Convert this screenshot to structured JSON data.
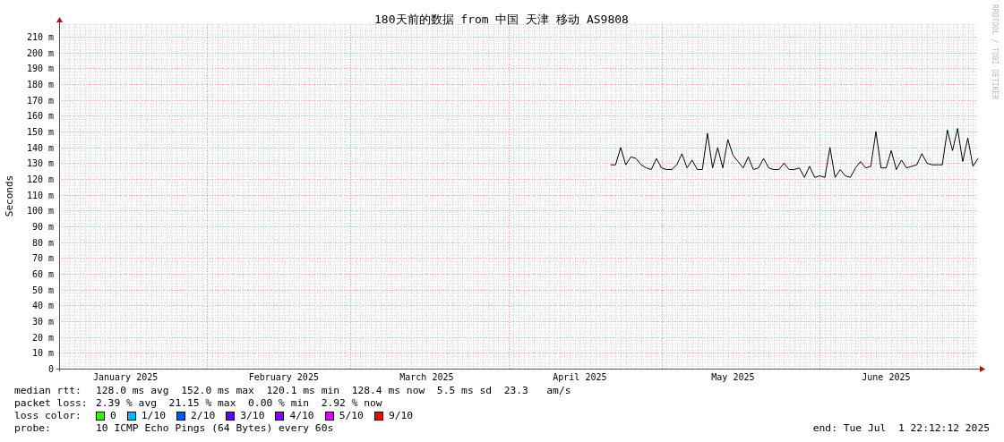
{
  "graph": {
    "credit": "RRDTOOL / TOBI OETIKER",
    "chart_data": {
      "type": "line",
      "title": "180天前的数据 from 中国 天津 移动 AS9808",
      "ylabel": "Seconds",
      "ylim": [
        0,
        218
      ],
      "grid": true,
      "categories": [
        null,
        null,
        null,
        null,
        null,
        null,
        null,
        null,
        null,
        null,
        null,
        null,
        null,
        "January 2025",
        null,
        null,
        null,
        null,
        null,
        null,
        null,
        null,
        null,
        null,
        null,
        null,
        null,
        null,
        null,
        null,
        null,
        null,
        null,
        null,
        null,
        null,
        null,
        null,
        null,
        null,
        null,
        null,
        null,
        null,
        "February 2025",
        null,
        null,
        null,
        null,
        null,
        null,
        null,
        null,
        null,
        null,
        null,
        null,
        null,
        null,
        null,
        null,
        null,
        null,
        null,
        null,
        null,
        null,
        null,
        null,
        null,
        null,
        null,
        "March 2025",
        null,
        null,
        null,
        null,
        null,
        null,
        null,
        null,
        null,
        null,
        null,
        null,
        null,
        null,
        null,
        null,
        null,
        null,
        null,
        null,
        null,
        null,
        null,
        null,
        null,
        null,
        null,
        null,
        null,
        "April 2025",
        null,
        null,
        null,
        null,
        null,
        null,
        null,
        null,
        null,
        null,
        null,
        null,
        null,
        null,
        null,
        null,
        null,
        null,
        null,
        null,
        null,
        null,
        null,
        null,
        null,
        null,
        null,
        null,
        null,
        "May 2025",
        null,
        null,
        null,
        null,
        null,
        null,
        null,
        null,
        null,
        null,
        null,
        null,
        null,
        null,
        null,
        null,
        null,
        null,
        null,
        null,
        null,
        null,
        null,
        null,
        null,
        null,
        null,
        null,
        null,
        "June 2025",
        null,
        null,
        null,
        null,
        null,
        null,
        null,
        null,
        null,
        null,
        null,
        null,
        null,
        null,
        null,
        null,
        null,
        null
      ],
      "yticks": [
        {
          "value": 0,
          "label": "0"
        },
        {
          "value": 10,
          "label": "10 m"
        },
        {
          "value": 20,
          "label": "20 m"
        },
        {
          "value": 30,
          "label": "30 m"
        },
        {
          "value": 40,
          "label": "40 m"
        },
        {
          "value": 50,
          "label": "50 m"
        },
        {
          "value": 60,
          "label": "60 m"
        },
        {
          "value": 70,
          "label": "70 m"
        },
        {
          "value": 80,
          "label": "80 m"
        },
        {
          "value": 90,
          "label": "90 m"
        },
        {
          "value": 100,
          "label": "100 m"
        },
        {
          "value": 110,
          "label": "110 m"
        },
        {
          "value": 120,
          "label": "120 m"
        },
        {
          "value": 130,
          "label": "130 m"
        },
        {
          "value": 140,
          "label": "140 m"
        },
        {
          "value": 150,
          "label": "150 m"
        },
        {
          "value": 160,
          "label": "160 m"
        },
        {
          "value": 170,
          "label": "170 m"
        },
        {
          "value": 180,
          "label": "180 m"
        },
        {
          "value": 190,
          "label": "190 m"
        },
        {
          "value": 200,
          "label": "200 m"
        },
        {
          "value": 210,
          "label": "210 m"
        }
      ],
      "series": [
        {
          "name": "median rtt:",
          "color": "#000000",
          "values": [
            null,
            null,
            null,
            null,
            null,
            null,
            null,
            null,
            null,
            null,
            null,
            null,
            null,
            null,
            null,
            null,
            null,
            null,
            null,
            null,
            null,
            null,
            null,
            null,
            null,
            null,
            null,
            null,
            null,
            null,
            null,
            null,
            null,
            null,
            null,
            null,
            null,
            null,
            null,
            null,
            null,
            null,
            null,
            null,
            null,
            null,
            null,
            null,
            null,
            null,
            null,
            null,
            null,
            null,
            null,
            null,
            null,
            null,
            null,
            null,
            null,
            null,
            null,
            null,
            null,
            null,
            null,
            null,
            null,
            null,
            null,
            null,
            null,
            null,
            null,
            null,
            null,
            null,
            null,
            null,
            null,
            null,
            null,
            null,
            null,
            null,
            null,
            null,
            null,
            null,
            null,
            null,
            null,
            null,
            null,
            null,
            null,
            null,
            null,
            null,
            null,
            null,
            null,
            null,
            null,
            null,
            null,
            null,
            129,
            129,
            140,
            129,
            134,
            133,
            129,
            127,
            126,
            133,
            127,
            126,
            126,
            129,
            136,
            127,
            132,
            126,
            126,
            149,
            127,
            140,
            127,
            145,
            135,
            131,
            127,
            134,
            126,
            127,
            133,
            127,
            126,
            126,
            130,
            126,
            126,
            127,
            121,
            128,
            121,
            122,
            121,
            140,
            121,
            126,
            122,
            121,
            127,
            131,
            127,
            128,
            150,
            127,
            127,
            138,
            126,
            132,
            127,
            128,
            129,
            136,
            130,
            129,
            129,
            129,
            151,
            138,
            152,
            131,
            146,
            128,
            133
          ]
        }
      ]
    }
  },
  "legend": {
    "median_rtt": {
      "text": "128.0 ms avg  152.0 ms max  120.1 ms min  128.4 ms now  5.5 ms sd  23.3   am/s"
    },
    "packet_loss": {
      "label": "packet loss:",
      "text": "2.39 % avg  21.15 % max  0.00 % min  2.92 % now"
    },
    "loss_color": {
      "label": "loss color:",
      "items": [
        {
          "label": "0",
          "color": "#26ff00"
        },
        {
          "label": "1/10",
          "color": "#00b8ff"
        },
        {
          "label": "2/10",
          "color": "#0059ff"
        },
        {
          "label": "3/10",
          "color": "#5e00ff"
        },
        {
          "label": "4/10",
          "color": "#7e00ff"
        },
        {
          "label": "5/10",
          "color": "#dd00ff"
        },
        {
          "label": "9/10",
          "color": "#ff0000"
        }
      ]
    },
    "probe": {
      "label": "probe:",
      "text": "10 ICMP Echo Pings (64 Bytes) every 60s"
    },
    "end": "end: Tue Jul  1 22:12:12 2025"
  }
}
